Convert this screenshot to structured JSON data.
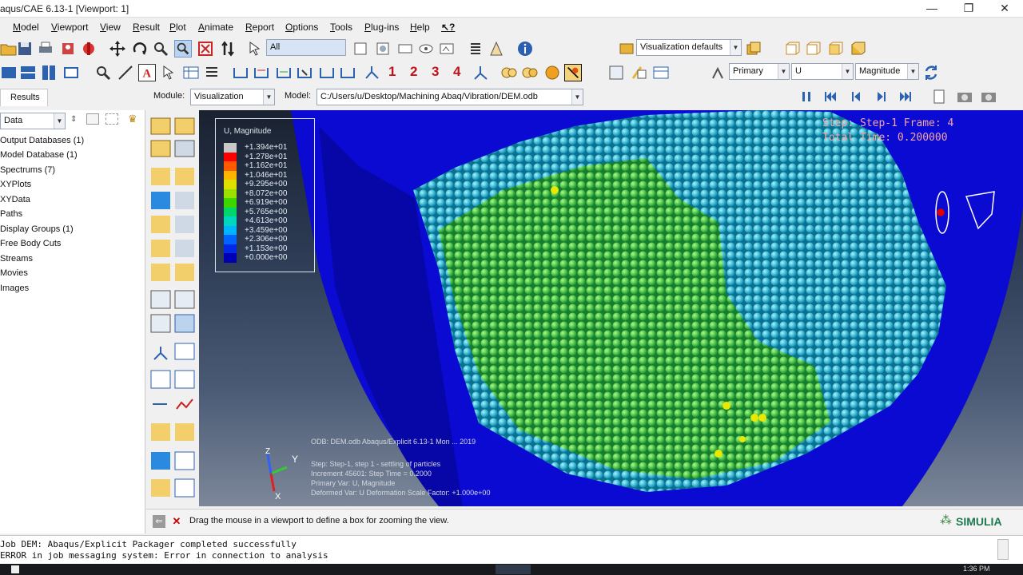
{
  "window": {
    "title": "aqus/CAE 6.13-1 [Viewport: 1]",
    "controls": [
      "—",
      "❐",
      "✕"
    ]
  },
  "menu": [
    "Model",
    "Viewport",
    "View",
    "Result",
    "Plot",
    "Animate",
    "Report",
    "Options",
    "Tools",
    "Plug-ins",
    "Help"
  ],
  "toolbar": {
    "selection_filter": "All",
    "visualization_defaults": "Visualization defaults",
    "numbers": [
      "1",
      "2",
      "3",
      "4"
    ],
    "primary": "Primary",
    "variable": "U",
    "invariant": "Magnitude"
  },
  "context": {
    "module_label": "Module:",
    "module_value": "Visualization",
    "model_label": "Model:",
    "model_value": "C:/Users/u/Desktop/Machining Abaq/Vibration/DEM.odb"
  },
  "tree": {
    "tab": "Results",
    "filter": "Data",
    "items": [
      "Output Databases (1)",
      "Model Database (1)",
      "Spectrums (7)",
      "XYPlots",
      "XYData",
      "Paths",
      "Display Groups (1)",
      "Free Body Cuts",
      "Streams",
      "Movies",
      "Images"
    ]
  },
  "legend": {
    "title": "U, Magnitude",
    "values": [
      "+1.394e+01",
      "+1.278e+01",
      "+1.162e+01",
      "+1.046e+01",
      "+9.295e+00",
      "+8.072e+00",
      "+6.919e+00",
      "+5.765e+00",
      "+4.613e+00",
      "+3.459e+00",
      "+2.306e+00",
      "+1.153e+00",
      "+0.000e+00"
    ],
    "colors": [
      "#c8c8c8",
      "#ff0000",
      "#ff5a00",
      "#ffb400",
      "#e0e000",
      "#9ae000",
      "#3ed600",
      "#00d66a",
      "#00d6c0",
      "#00b4ff",
      "#0064ff",
      "#0028e6",
      "#0000b0"
    ]
  },
  "hud": {
    "step_line": "Step: Step-1    Frame: 4",
    "time_line": "Total Time: 0.200000"
  },
  "viewport_info": {
    "odb_line": "ODB: DEM.odb    Abaqus/Explicit 6.13-1    Mon ... 2019",
    "step_text": "Step: Step-1, step 1 - settling of particles",
    "increment_text": "Increment    45601: Step Time =    0.2000",
    "primary_text": "Primary Var: U, Magnitude",
    "deformed_text": "Deformed Var: U   Deformation Scale Factor: +1.000e+00"
  },
  "triad": {
    "y": "Y",
    "z": "Z",
    "x": "X"
  },
  "prompt": {
    "text": "Drag the mouse in a viewport to define a box for zooming the view."
  },
  "brand": "SIMULIA",
  "messages": [
    "Job DEM: Abaqus/Explicit Packager completed successfully",
    "ERROR in job messaging system: Error in connection to analysis"
  ],
  "taskbar": {
    "clock": "1:36 PM"
  }
}
